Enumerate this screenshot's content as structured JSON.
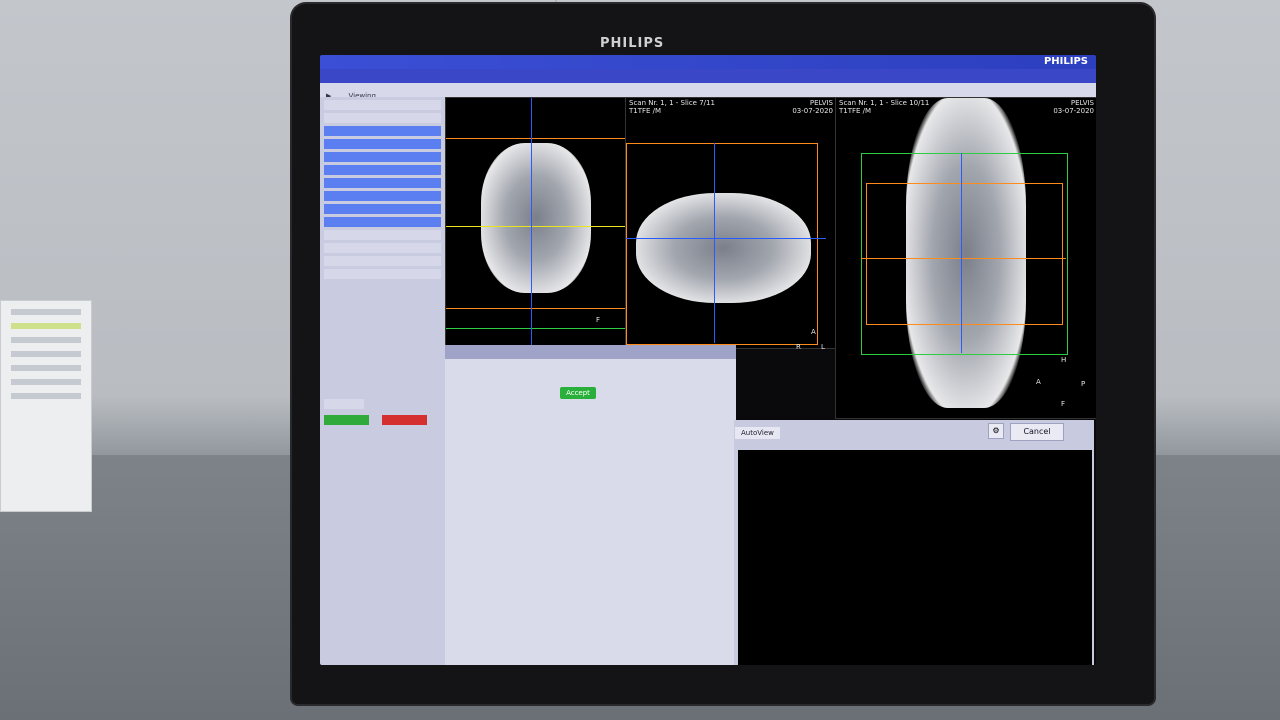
{
  "monitor": {
    "brand": "PHILIPS"
  },
  "app": {
    "logo": "PHILIPS"
  },
  "toolbar": {
    "mode_label": "Viewing"
  },
  "viewports": [
    {
      "scan_label": "Scan Nr. 1, 1 - Slice 7/11",
      "seq": "T1TFE  /M",
      "region": "PELVIS",
      "date": "03-07-2020"
    },
    {
      "scan_label": "Scan Nr. 1, 1 - Slice 10/11",
      "seq": "T1TFE  /M",
      "region": "PELVIS",
      "date": "03-07-2020"
    }
  ],
  "orientation": {
    "A": "A",
    "P": "P",
    "R": "R",
    "L": "L",
    "H": "H",
    "F": "F"
  },
  "buttons": {
    "accept": "Accept",
    "cancel": "Cancel"
  },
  "console": {
    "tab_active": "AutoView"
  },
  "colors": {
    "accent_blue": "#3b4fd6",
    "accept_green": "#29b03a",
    "stop_red": "#d43030",
    "line_green": "#2ecc40",
    "line_orange": "#ff8c1a",
    "line_yellow": "#e6e61a",
    "line_blue": "#2a5bff"
  }
}
